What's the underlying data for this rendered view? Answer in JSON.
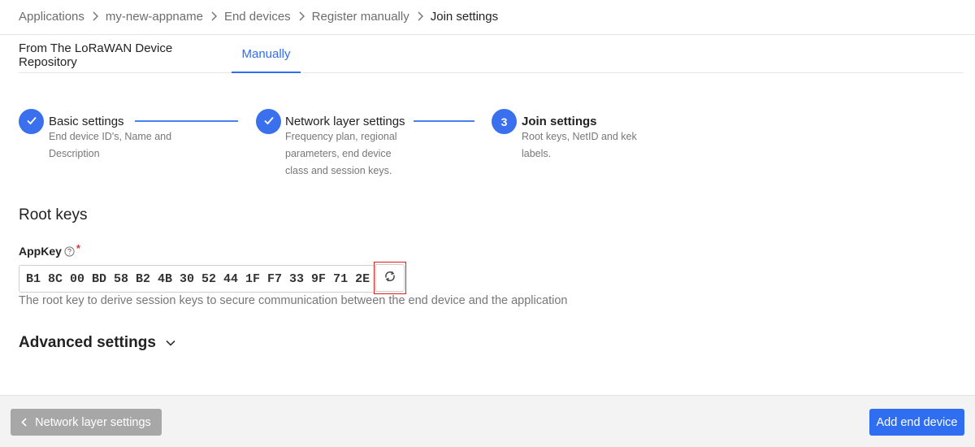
{
  "breadcrumb": {
    "items": [
      "Applications",
      "my-new-appname",
      "End devices",
      "Register manually",
      "Join settings"
    ]
  },
  "tabs": [
    {
      "label": "From The LoRaWAN Device Repository",
      "active": false
    },
    {
      "label": "Manually",
      "active": true
    }
  ],
  "steps": [
    {
      "status": "done",
      "icon": "checkmark-icon",
      "title": "Basic settings",
      "description_lines": [
        "End device ID's, Name and",
        "Description"
      ]
    },
    {
      "status": "done",
      "icon": "checkmark-icon",
      "title": "Network layer settings",
      "description_lines": [
        "Frequency plan, regional",
        "parameters, end device",
        "class and session keys."
      ]
    },
    {
      "status": "current",
      "number": "3",
      "title": "Join settings",
      "description_lines": [
        "Root keys, NetID and kek",
        "labels."
      ]
    }
  ],
  "root_keys": {
    "section_title": "Root keys",
    "app_key": {
      "label": "AppKey",
      "required_mark": "*",
      "value": "B1 8C 00 BD 58 B2 4B 30 52 44 1F F7 33 9F 71 2E",
      "description": "The root key to derive session keys to secure communication between the end device and the application"
    }
  },
  "advanced": {
    "label": "Advanced settings",
    "expanded": false
  },
  "footer": {
    "back_label": "Network layer settings",
    "submit_label": "Add end device"
  },
  "colors": {
    "accent": "#2f6ef0",
    "highlight": "#d9231a",
    "back_button": "#a7a7a7"
  }
}
